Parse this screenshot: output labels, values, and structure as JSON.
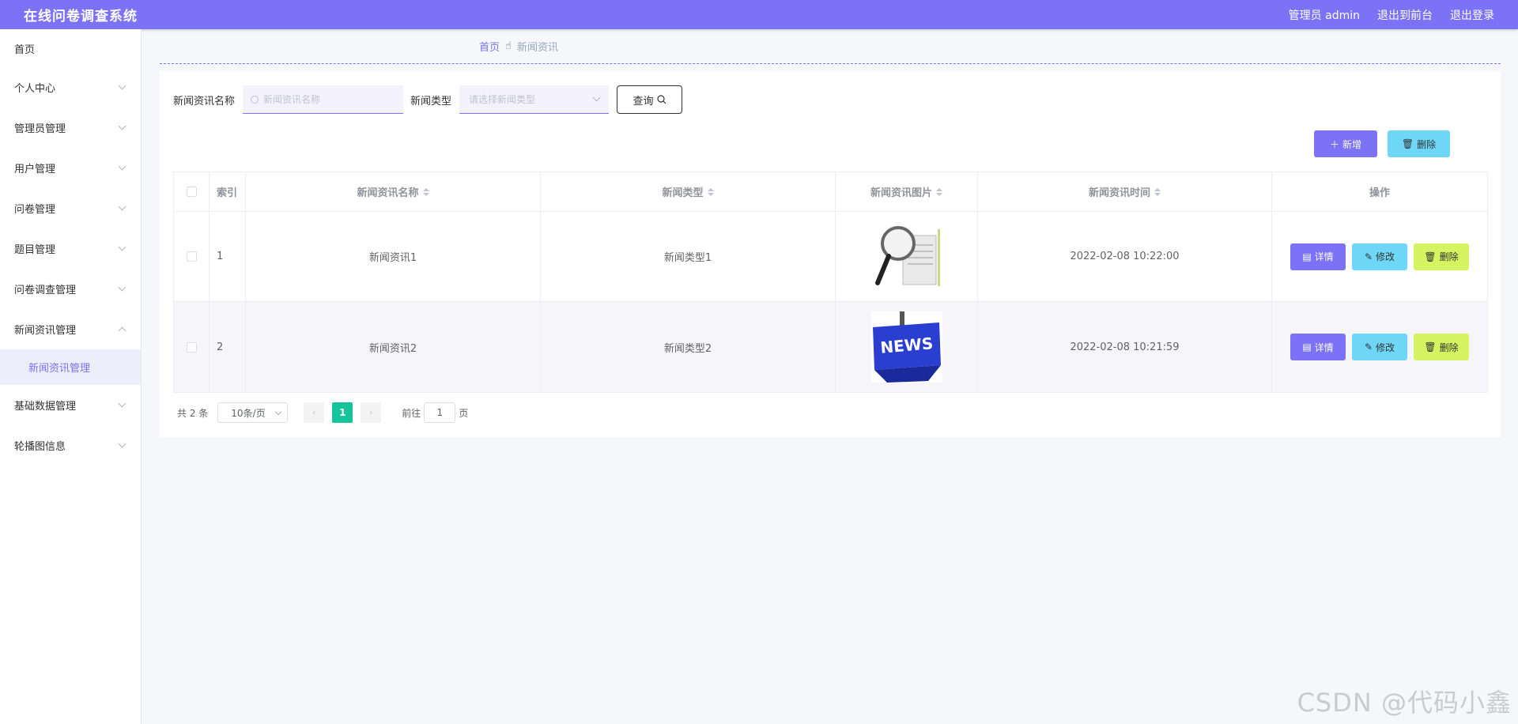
{
  "header": {
    "title": "在线问卷调查系统",
    "user": "管理员 admin",
    "to_front": "退出到前台",
    "logout": "退出登录"
  },
  "sidebar": {
    "items": [
      {
        "label": "首页"
      },
      {
        "label": "个人中心"
      },
      {
        "label": "管理员管理"
      },
      {
        "label": "用户管理"
      },
      {
        "label": "问卷管理"
      },
      {
        "label": "题目管理"
      },
      {
        "label": "问卷调查管理"
      },
      {
        "label": "新闻资讯管理"
      },
      {
        "label": "基础数据管理"
      },
      {
        "label": "轮播图信息"
      }
    ],
    "sub_item": "新闻资讯管理"
  },
  "breadcrumb": {
    "home": "首页",
    "current": "新闻资讯"
  },
  "search": {
    "name_label": "新闻资讯名称",
    "name_placeholder": "新闻资讯名称",
    "type_label": "新闻类型",
    "type_placeholder": "请选择新闻类型",
    "query_label": "查询"
  },
  "actions": {
    "add_label": "新增",
    "delete_label": "删除"
  },
  "table": {
    "headers": [
      "索引",
      "新闻资讯名称",
      "新闻类型",
      "新闻资讯图片",
      "新闻资讯时间",
      "操作"
    ],
    "rows": [
      {
        "index": "1",
        "name": "新闻资讯1",
        "type": "新闻类型1",
        "time": "2022-02-08 10:22:00"
      },
      {
        "index": "2",
        "name": "新闻资讯2",
        "type": "新闻类型2",
        "time": "2022-02-08 10:21:59"
      }
    ],
    "op_detail": "详情",
    "op_edit": "修改",
    "op_delete": "删除"
  },
  "pagination": {
    "total": "共 2 条",
    "page_size": "10条/页",
    "current_page": "1",
    "goto_prefix": "前往",
    "goto_value": "1",
    "goto_suffix": "页"
  },
  "watermark": "CSDN @代码小鑫",
  "colors": {
    "primary": "#7b72f5",
    "cyan": "#6ed7f7",
    "lime": "#d4f561",
    "page_active": "#16c39b"
  }
}
